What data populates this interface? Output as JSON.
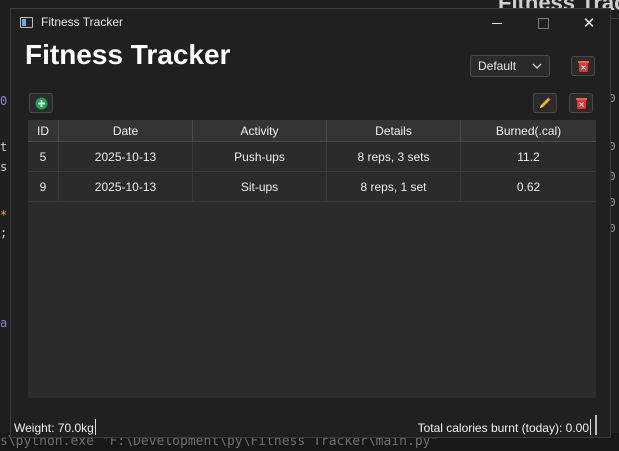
{
  "background": {
    "right_title": "Fitness Trac",
    "right_digits": [
      "0",
      "0",
      "0",
      "0",
      "0"
    ],
    "terminal_line": "s\\python.exe \"F:\\Development\\py\\Fitness Tracker\\main.py\""
  },
  "window": {
    "title": "Fitness Tracker",
    "controls": {
      "minimize": "minimize",
      "maximize": "maximize",
      "close": "✕"
    }
  },
  "app": {
    "title": "Fitness Tracker",
    "profile_select": {
      "value": "Default"
    }
  },
  "table": {
    "columns": [
      "ID",
      "Date",
      "Activity",
      "Details",
      "Burned(.cal)"
    ],
    "rows": [
      {
        "id": "5",
        "date": "2025-10-13",
        "activity": "Push-ups",
        "details": "8 reps, 3 sets",
        "burned": "11.2"
      },
      {
        "id": "9",
        "date": "2025-10-13",
        "activity": "Sit-ups",
        "details": "8 reps, 1 set",
        "burned": "0.62"
      }
    ]
  },
  "status": {
    "weight": "Weight: 70.0kg",
    "total_calories": "Total calories burnt (today): 0.00"
  },
  "colors": {
    "add": "#1aa54a",
    "delete": "#e0342b",
    "edit": "#f2b705"
  },
  "icons": [
    "app-icon",
    "chevron-down-icon",
    "plus-circle-icon",
    "pencil-icon",
    "trash-icon"
  ]
}
